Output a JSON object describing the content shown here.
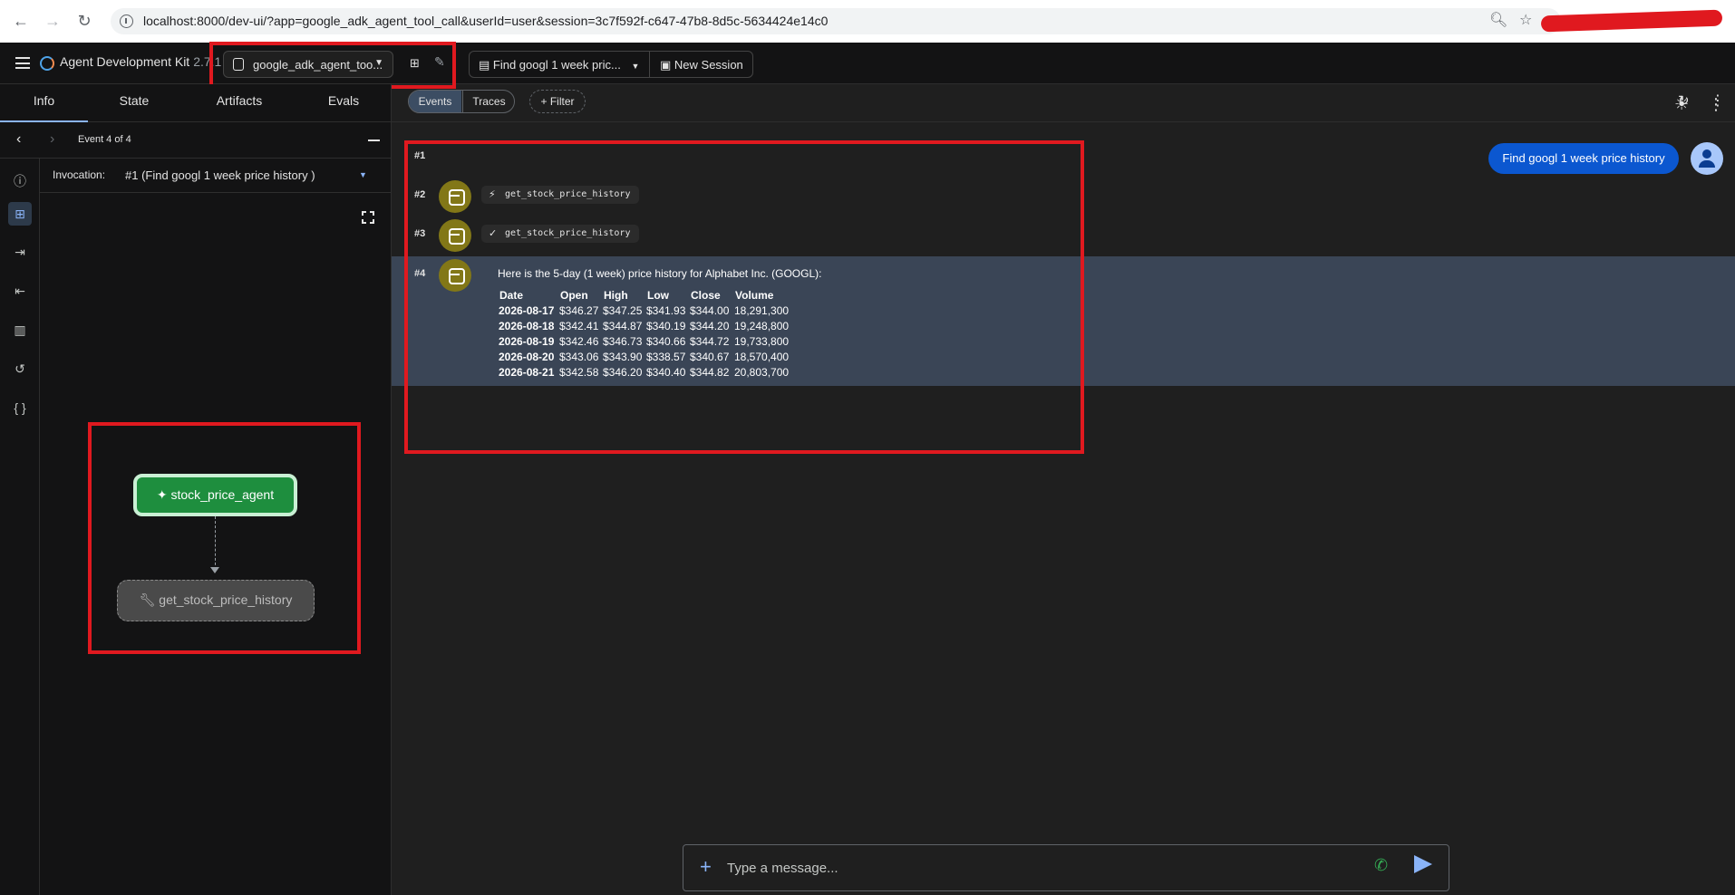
{
  "browser": {
    "url": "localhost:8000/dev-ui/?app=google_adk_agent_tool_call&userId=user&session=3c7f592f-c647-47b8-8d5c-5634424e14c0"
  },
  "app": {
    "title": "Agent Development Kit",
    "version": "2.7.1",
    "agent_selector": "google_adk_agent_too...",
    "session_title": "Find googl 1 week pric...",
    "new_session": "New Session"
  },
  "left_tabs": [
    "Info",
    "State",
    "Artifacts",
    "Evals"
  ],
  "event_nav": {
    "label": "Event 4 of 4"
  },
  "invocation": {
    "label": "Invocation:",
    "value": "#1 (Find googl 1 week price history )"
  },
  "graph": {
    "agent_node": "stock_price_agent",
    "tool_node": "get_stock_price_history"
  },
  "events_toolbar": {
    "events_tab": "Events",
    "traces_tab": "Traces",
    "filter": "Filter"
  },
  "events": [
    {
      "num": "#1"
    },
    {
      "num": "#2",
      "chip": "get_stock_price_history",
      "chip_icon": "bolt-icon"
    },
    {
      "num": "#3",
      "chip": "get_stock_price_history",
      "chip_icon": "check-icon"
    },
    {
      "num": "#4",
      "intro": "Here is the 5-day (1 week) price history for Alphabet Inc. (GOOGL):",
      "table": {
        "headers": [
          "Date",
          "Open",
          "High",
          "Low",
          "Close",
          "Volume"
        ],
        "rows": [
          [
            "2026-08-17",
            "$346.27",
            "$347.25",
            "$341.93",
            "$344.00",
            "18,291,300"
          ],
          [
            "2026-08-18",
            "$342.41",
            "$344.87",
            "$340.19",
            "$344.20",
            "19,248,800"
          ],
          [
            "2026-08-19",
            "$342.46",
            "$346.73",
            "$340.66",
            "$344.72",
            "19,733,800"
          ],
          [
            "2026-08-20",
            "$343.06",
            "$343.90",
            "$338.57",
            "$340.67",
            "18,570,400"
          ],
          [
            "2026-08-21",
            "$342.58",
            "$346.20",
            "$340.40",
            "$344.82",
            "20,803,700"
          ]
        ]
      }
    }
  ],
  "user_message": "Find googl 1 week price history",
  "composer": {
    "placeholder": "Type a message..."
  },
  "colors": {
    "highlight_box": "#e0191f",
    "agent_node": "#1e8e3e",
    "user_bubble": "#0b57d0",
    "bot_avatar": "#827717",
    "selected_event": "#3a4556"
  }
}
